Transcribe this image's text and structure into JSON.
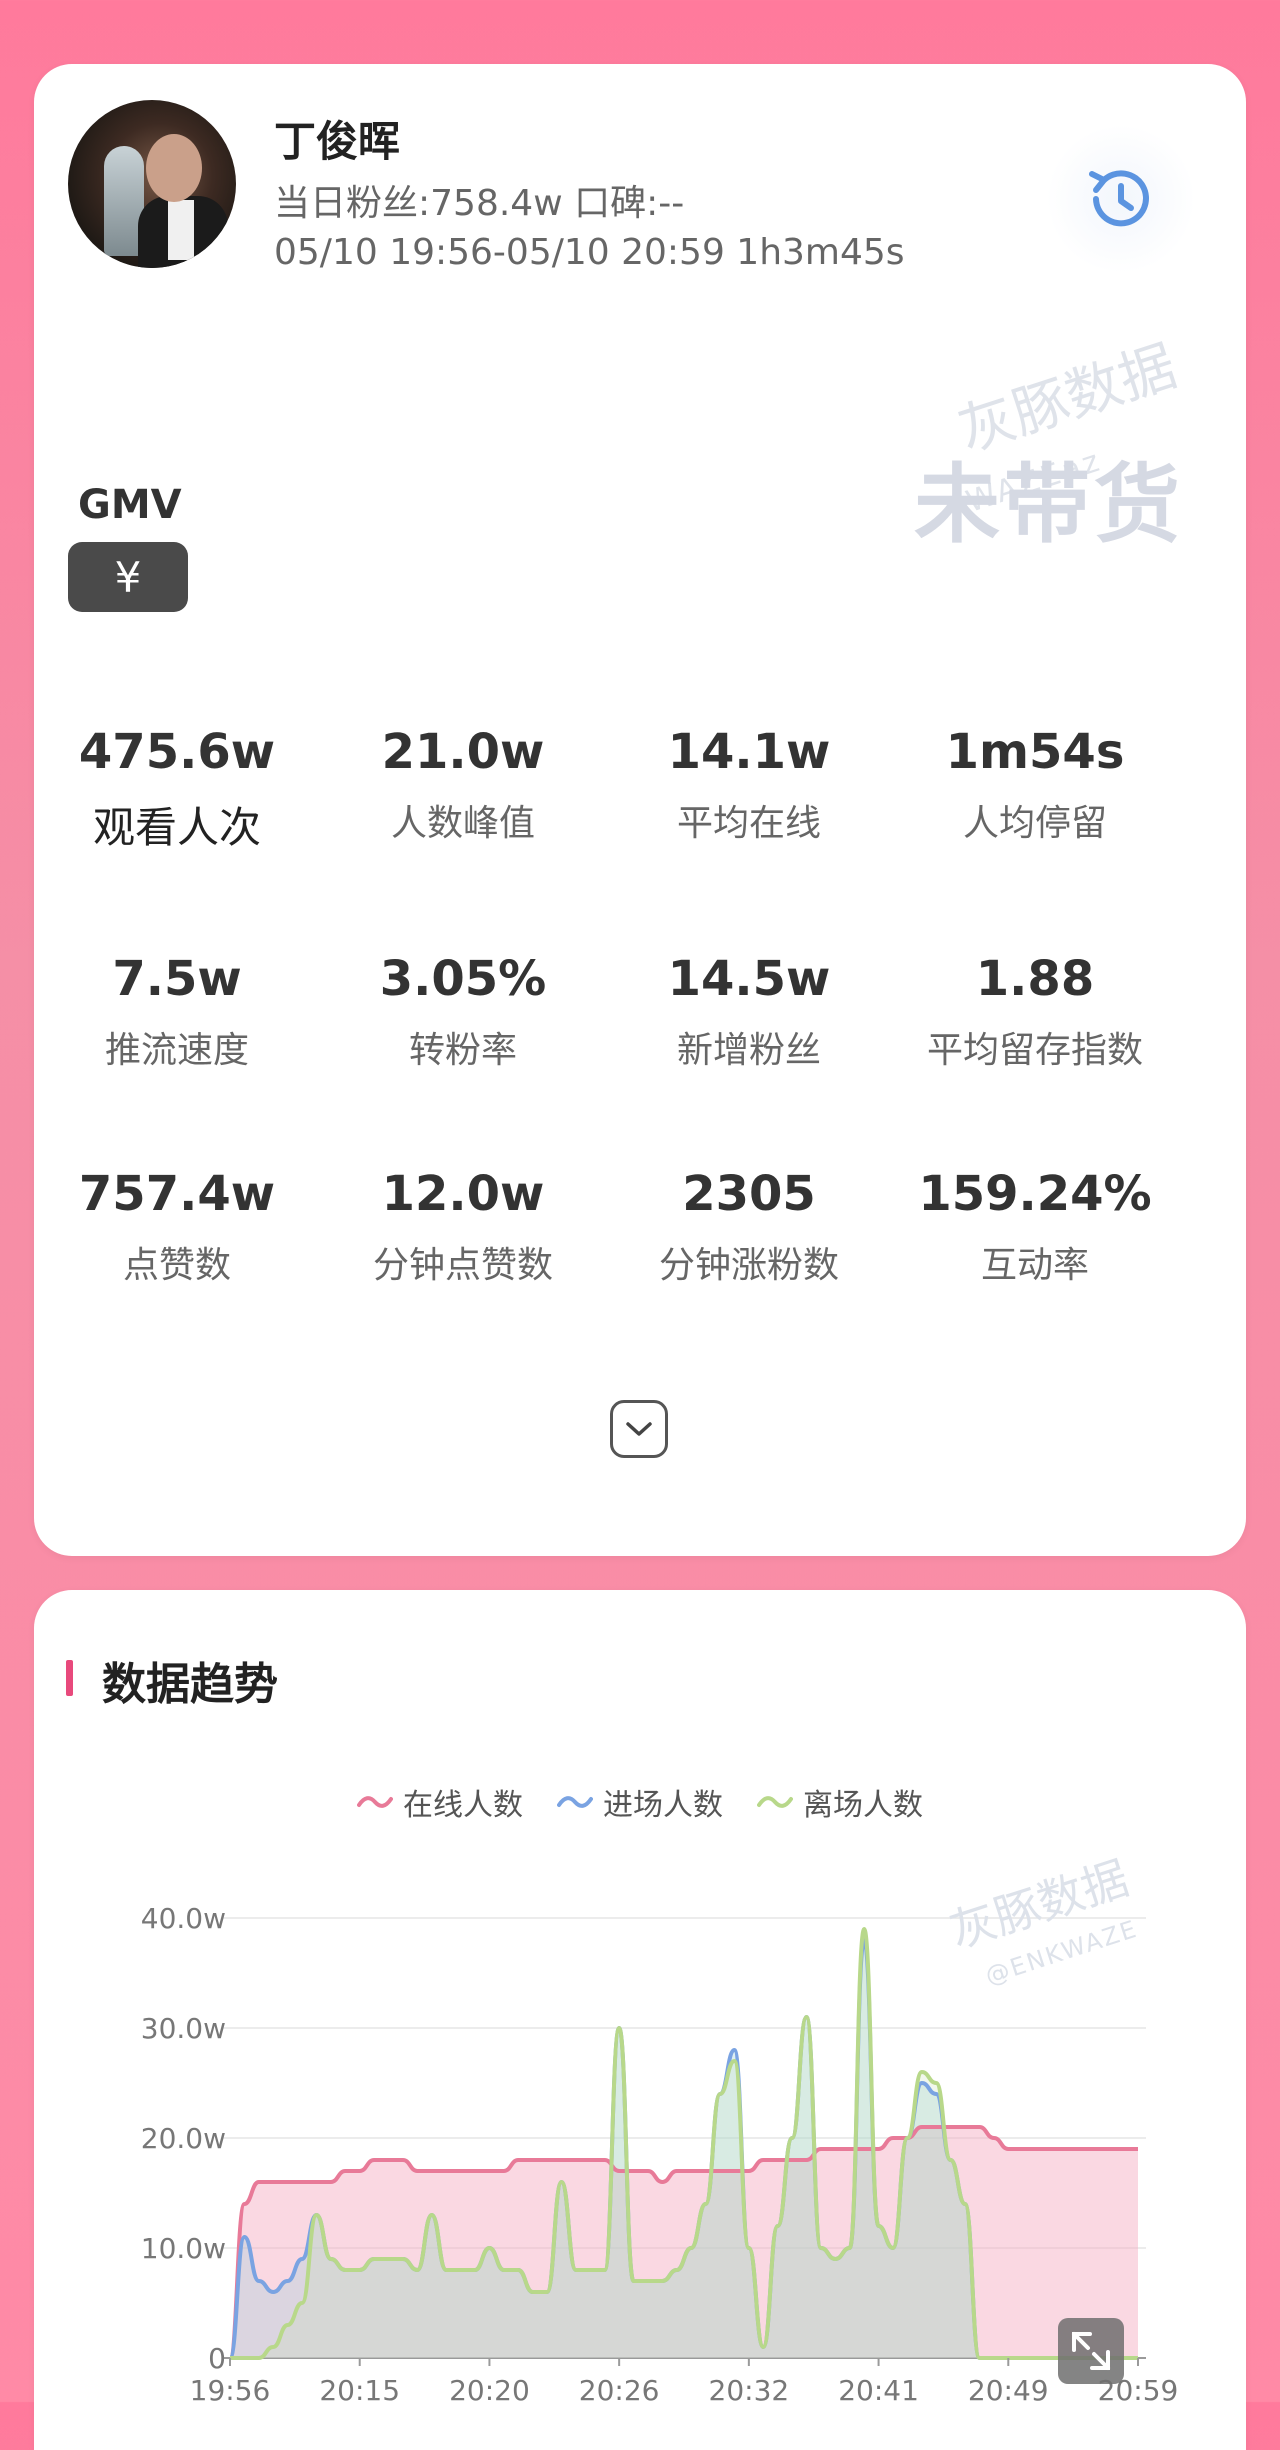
{
  "profile": {
    "name": "丁俊晖",
    "fans_line": "当日粉丝:758.4w   口碑:--",
    "time_line": "05/10 19:56-05/10 20:59   1h3m45s",
    "watermark_cn": "灰豚数据",
    "watermark_en": "WAZEaz",
    "status_watermark": "未带货"
  },
  "gmv": {
    "label": "GMV",
    "button_symbol": "¥"
  },
  "stats": [
    {
      "value": "475.6w",
      "label": "观看人次"
    },
    {
      "value": "21.0w",
      "label": "人数峰值"
    },
    {
      "value": "14.1w",
      "label": "平均在线"
    },
    {
      "value": "1m54s",
      "label": "人均停留"
    },
    {
      "value": "7.5w",
      "label": "推流速度"
    },
    {
      "value": "3.05%",
      "label": "转粉率"
    },
    {
      "value": "14.5w",
      "label": "新增粉丝"
    },
    {
      "value": "1.88",
      "label": "平均留存指数"
    },
    {
      "value": "757.4w",
      "label": "点赞数"
    },
    {
      "value": "12.0w",
      "label": "分钟点赞数"
    },
    {
      "value": "2305",
      "label": "分钟涨粉数"
    },
    {
      "value": "159.24%",
      "label": "互动率"
    }
  ],
  "trend": {
    "section_title": "数据趋势",
    "watermark_cn": "灰豚数据",
    "watermark_en": "@ENKWAZE"
  },
  "colors": {
    "online": "#e87a98",
    "enter": "#7aa3e2",
    "leave": "#b8d88a",
    "accent": "#e8497c"
  },
  "chart_data": {
    "type": "area",
    "legend": [
      "在线人数",
      "进场人数",
      "离场人数"
    ],
    "ylim": [
      0,
      40
    ],
    "yticks": [
      "0",
      "10.0w",
      "20.0w",
      "30.0w",
      "40.0w"
    ],
    "xticks": [
      "19:56",
      "20:15",
      "20:20",
      "20:26",
      "20:32",
      "20:41",
      "20:49",
      "20:59"
    ],
    "x_minutes": [
      0,
      1,
      2,
      3,
      4,
      5,
      6,
      7,
      8,
      9,
      10,
      11,
      12,
      13,
      14,
      15,
      16,
      17,
      18,
      19,
      20,
      21,
      22,
      23,
      24,
      25,
      26,
      27,
      28,
      29,
      30,
      31,
      32,
      33,
      34,
      35,
      36,
      37,
      38,
      39,
      40,
      41,
      42,
      43,
      44,
      45,
      46,
      47,
      48,
      49,
      50,
      51,
      52,
      53,
      54,
      55,
      56,
      57,
      58,
      59,
      60,
      61,
      62,
      63
    ],
    "series": [
      {
        "name": "在线人数",
        "values": [
          0,
          14,
          16,
          16,
          16,
          16,
          16,
          16,
          17,
          17,
          18,
          18,
          18,
          17,
          17,
          17,
          17,
          17,
          17,
          17,
          18,
          18,
          18,
          18,
          18,
          18,
          18,
          17,
          17,
          17,
          16,
          17,
          17,
          17,
          17,
          17,
          17,
          18,
          18,
          18,
          18,
          19,
          19,
          19,
          19,
          19,
          20,
          20,
          21,
          21,
          21,
          21,
          21,
          20,
          19,
          19,
          19,
          19,
          19,
          19,
          19,
          19,
          19,
          19
        ]
      },
      {
        "name": "进场人数",
        "values": [
          0,
          11,
          7,
          6,
          7,
          9,
          13,
          9,
          8,
          8,
          9,
          9,
          9,
          8,
          13,
          8,
          8,
          8,
          10,
          8,
          8,
          6,
          6,
          16,
          8,
          8,
          8,
          30,
          7,
          7,
          7,
          8,
          10,
          14,
          24,
          28,
          10,
          1,
          12,
          20,
          31,
          10,
          9,
          10,
          38,
          12,
          10,
          20,
          25,
          24,
          18,
          14,
          0,
          0,
          0,
          0,
          0,
          0,
          0,
          0,
          0,
          0,
          0,
          0
        ]
      },
      {
        "name": "离场人数",
        "values": [
          0,
          0,
          0,
          1,
          3,
          5,
          13,
          9,
          8,
          8,
          9,
          9,
          9,
          8,
          13,
          8,
          8,
          8,
          10,
          8,
          8,
          6,
          6,
          16,
          8,
          8,
          8,
          30,
          7,
          7,
          7,
          8,
          10,
          14,
          24,
          27,
          10,
          1,
          12,
          20,
          31,
          10,
          9,
          10,
          39,
          12,
          10,
          20,
          26,
          25,
          18,
          14,
          0,
          0,
          0,
          0,
          0,
          0,
          0,
          0,
          0,
          0,
          0,
          0
        ]
      }
    ]
  }
}
